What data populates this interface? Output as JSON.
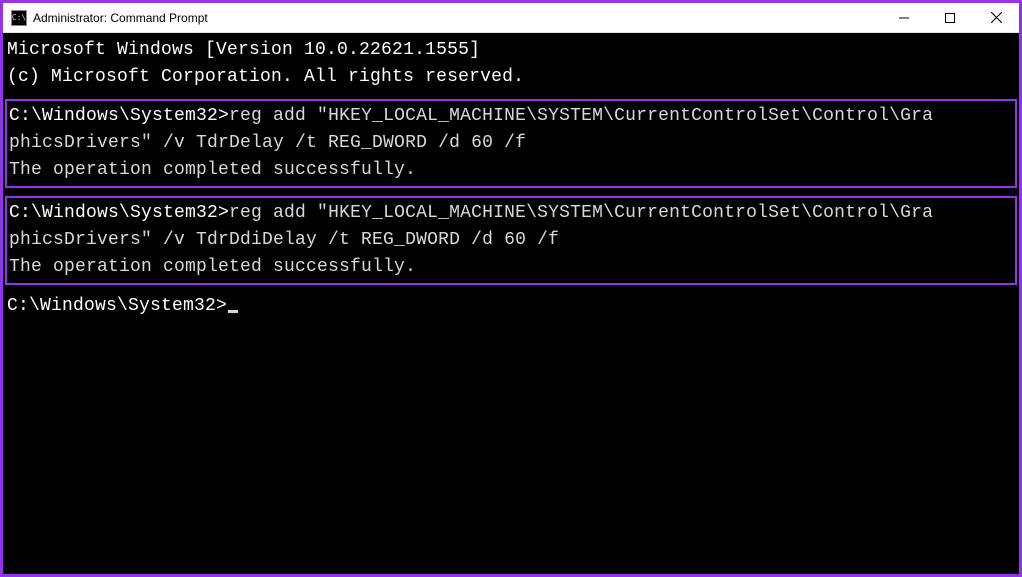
{
  "titlebar": {
    "title": "Administrator: Command Prompt"
  },
  "terminal": {
    "banner_line1": "Microsoft Windows [Version 10.0.22621.1555]",
    "banner_line2": "(c) Microsoft Corporation. All rights reserved.",
    "block1": {
      "prompt": "C:\\Windows\\System32>",
      "command_part1": "reg add \"HKEY_LOCAL_MACHINE\\SYSTEM\\CurrentControlSet\\Control\\Gra",
      "command_part2": "phicsDrivers\" /v TdrDelay /t REG_DWORD /d 60 /f",
      "result": "The operation completed successfully."
    },
    "block2": {
      "prompt": "C:\\Windows\\System32>",
      "command_part1": "reg add \"HKEY_LOCAL_MACHINE\\SYSTEM\\CurrentControlSet\\Control\\Gra",
      "command_part2": "phicsDrivers\" /v TdrDdiDelay /t REG_DWORD /d 60 /f",
      "result": "The operation completed successfully."
    },
    "final_prompt": "C:\\Windows\\System32>"
  }
}
